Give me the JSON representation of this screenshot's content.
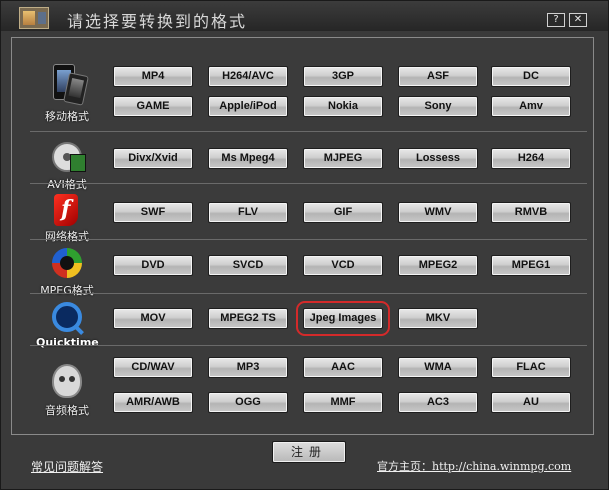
{
  "window": {
    "title": "请选择要转换到的格式",
    "help_label": "?",
    "close_label": "✕"
  },
  "categories": [
    {
      "label": "移动格式",
      "icon": "mobile-phone-icon",
      "buttons": [
        "MP4",
        "H264/AVC",
        "3GP",
        "ASF",
        "DC",
        "GAME",
        "Apple/iPod",
        "Nokia",
        "Sony",
        "Amv"
      ]
    },
    {
      "label": "AVI格式",
      "icon": "film-reel-icon",
      "buttons": [
        "Divx/Xvid",
        "Ms Mpeg4",
        "MJPEG",
        "Lossess",
        "H264"
      ]
    },
    {
      "label": "网络格式",
      "icon": "flash-icon",
      "buttons": [
        "SWF",
        "FLV",
        "GIF",
        "WMV",
        "RMVB"
      ]
    },
    {
      "label": "MPEG格式",
      "icon": "mpeg-disc-icon",
      "buttons": [
        "DVD",
        "SVCD",
        "VCD",
        "MPEG2",
        "MPEG1"
      ]
    },
    {
      "label": "Quicktime",
      "icon": "quicktime-icon",
      "buttons": [
        "MOV",
        "MPEG2 TS",
        "Jpeg Images",
        "MKV"
      ]
    },
    {
      "label": "音频格式",
      "icon": "audio-player-icon",
      "buttons": [
        "CD/WAV",
        "MP3",
        "AAC",
        "WMA",
        "FLAC",
        "AMR/AWB",
        "OGG",
        "MMF",
        "AC3",
        "AU"
      ]
    }
  ],
  "highlighted_button": "Jpeg Images",
  "highlight_color": "#d42a2a",
  "register_label": "注册",
  "footer": {
    "faq_label": "常见问题解答",
    "homepage_prefix": "官方主页：",
    "homepage_url": "http://china.winmpg.com"
  }
}
